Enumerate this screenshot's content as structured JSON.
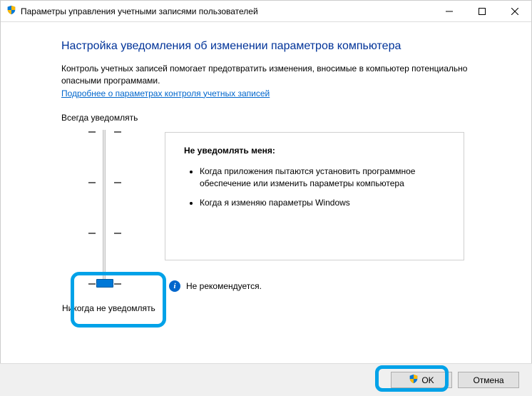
{
  "window": {
    "title": "Параметры управления учетными записями пользователей"
  },
  "main": {
    "heading": "Настройка уведомления об изменении параметров компьютера",
    "description": "Контроль учетных записей помогает предотвратить изменения, вносимые в компьютер потенциально опасными программами.",
    "link": "Подробнее о параметрах контроля учетных записей",
    "slider": {
      "top_label": "Всегда уведомлять",
      "bottom_label": "Никогда не уведомлять"
    },
    "info": {
      "title": "Не уведомлять меня:",
      "bullets": [
        "Когда приложения пытаются установить программное обеспечение или изменить параметры компьютера",
        "Когда я изменяю параметры Windows"
      ],
      "recommendation": "Не рекомендуется."
    }
  },
  "footer": {
    "ok": "OK",
    "cancel": "Отмена"
  }
}
